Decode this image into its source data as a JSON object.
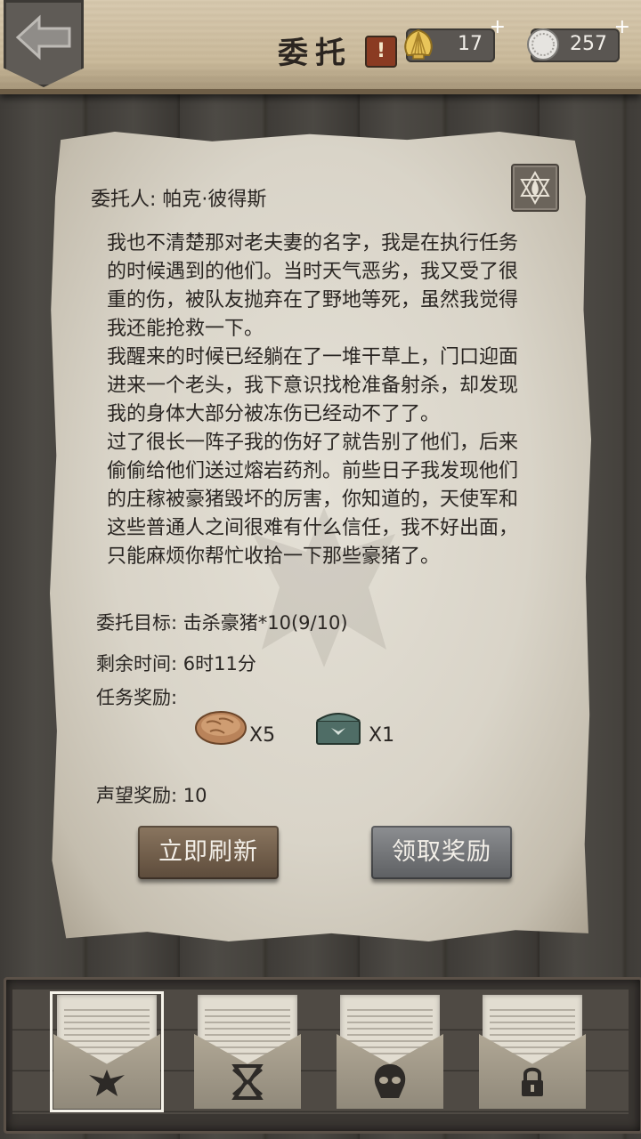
{
  "header": {
    "title": "委托",
    "shells": "17",
    "coins": "257",
    "plus": "+"
  },
  "quest": {
    "client": "委托人: 帕克·彼得斯",
    "story": [
      "我也不清楚那对老夫妻的名字，我是在执行任务的时候遇到的他们。当时天气恶劣，我又受了很重的伤，被队友抛弃在了野地等死，虽然我觉得我还能抢救一下。",
      "我醒来的时候已经躺在了一堆干草上，门口迎面进来一个老头，我下意识找枪准备射杀，却发现我的身体大部分被冻伤已经动不了了。",
      "过了很长一阵子我的伤好了就告别了他们，后来偷偷给他们送过熔岩药剂。前些日子我发现他们的庄稼被豪猪毁坏的厉害，你知道的，天使军和这些普通人之间很难有什么信任，我不好出面，只能麻烦你帮忙收拾一下那些豪猪了。"
    ],
    "target": "委托目标:  击杀豪猪*10(9/10)",
    "time_left": "剩余时间:  6时11分",
    "rewards_label": "任务奖励:",
    "rewards": [
      {
        "icon": "bread-icon",
        "qty": "X5"
      },
      {
        "icon": "chest-icon",
        "qty": "X1"
      }
    ],
    "reputation": "声望奖励:  10"
  },
  "buttons": {
    "refresh": "立即刷新",
    "claim": "领取奖励"
  },
  "letters": [
    {
      "icon": "eagle-crest-icon",
      "selected": true
    },
    {
      "icon": "hourglass-crest-icon",
      "selected": false
    },
    {
      "icon": "skull-crest-icon",
      "selected": false
    },
    {
      "icon": "lock-icon",
      "selected": false
    }
  ],
  "colors": {
    "header": "#cbbb9c",
    "paper": "#dcd7cb",
    "refresh_btn": "#6f5c49",
    "claim_btn": "#707275"
  }
}
